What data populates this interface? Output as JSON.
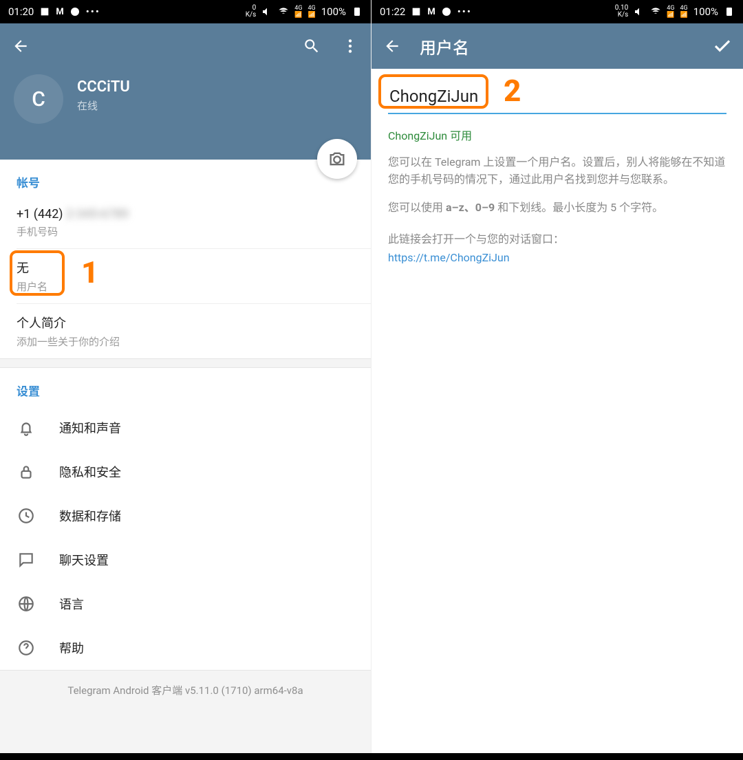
{
  "left": {
    "status": {
      "time": "01:20",
      "net": "0\nK/s",
      "battery": "100%"
    },
    "profile": {
      "avatar_letter": "C",
      "name": "CCCiTU",
      "status": "在线"
    },
    "account_section": "帐号",
    "phone": {
      "value": "+1 (442) ",
      "label": "手机号码"
    },
    "username": {
      "value": "无",
      "label": "用户名"
    },
    "bio": {
      "value": "个人简介",
      "label": "添加一些关于你的介绍"
    },
    "settings_section": "设置",
    "settings": [
      {
        "label": "通知和声音"
      },
      {
        "label": "隐私和安全"
      },
      {
        "label": "数据和存储"
      },
      {
        "label": "聊天设置"
      },
      {
        "label": "语言"
      },
      {
        "label": "帮助"
      }
    ],
    "version": "Telegram Android 客户端 v5.11.0 (1710) arm64-v8a",
    "annot_num": "1"
  },
  "right": {
    "status": {
      "time": "01:22",
      "net": "0.10\nK/s",
      "battery": "100%"
    },
    "title": "用户名",
    "input_value": "ChongZiJun",
    "available": "ChongZiJun 可用",
    "info_p1": "您可以在 Telegram 上设置一个用户名。设置后，别人将能够在不知道您的手机号码的情况下，通过此用户名找到您并与您联系。",
    "info_p2_a": "您可以使用 ",
    "info_p2_b": "a–z、0–9",
    "info_p2_c": " 和下划线。最小长度为 5 个字符。",
    "link_intro": "此链接会打开一个与您的对话窗口：",
    "link": "https://t.me/ChongZiJun",
    "annot_num": "2"
  }
}
